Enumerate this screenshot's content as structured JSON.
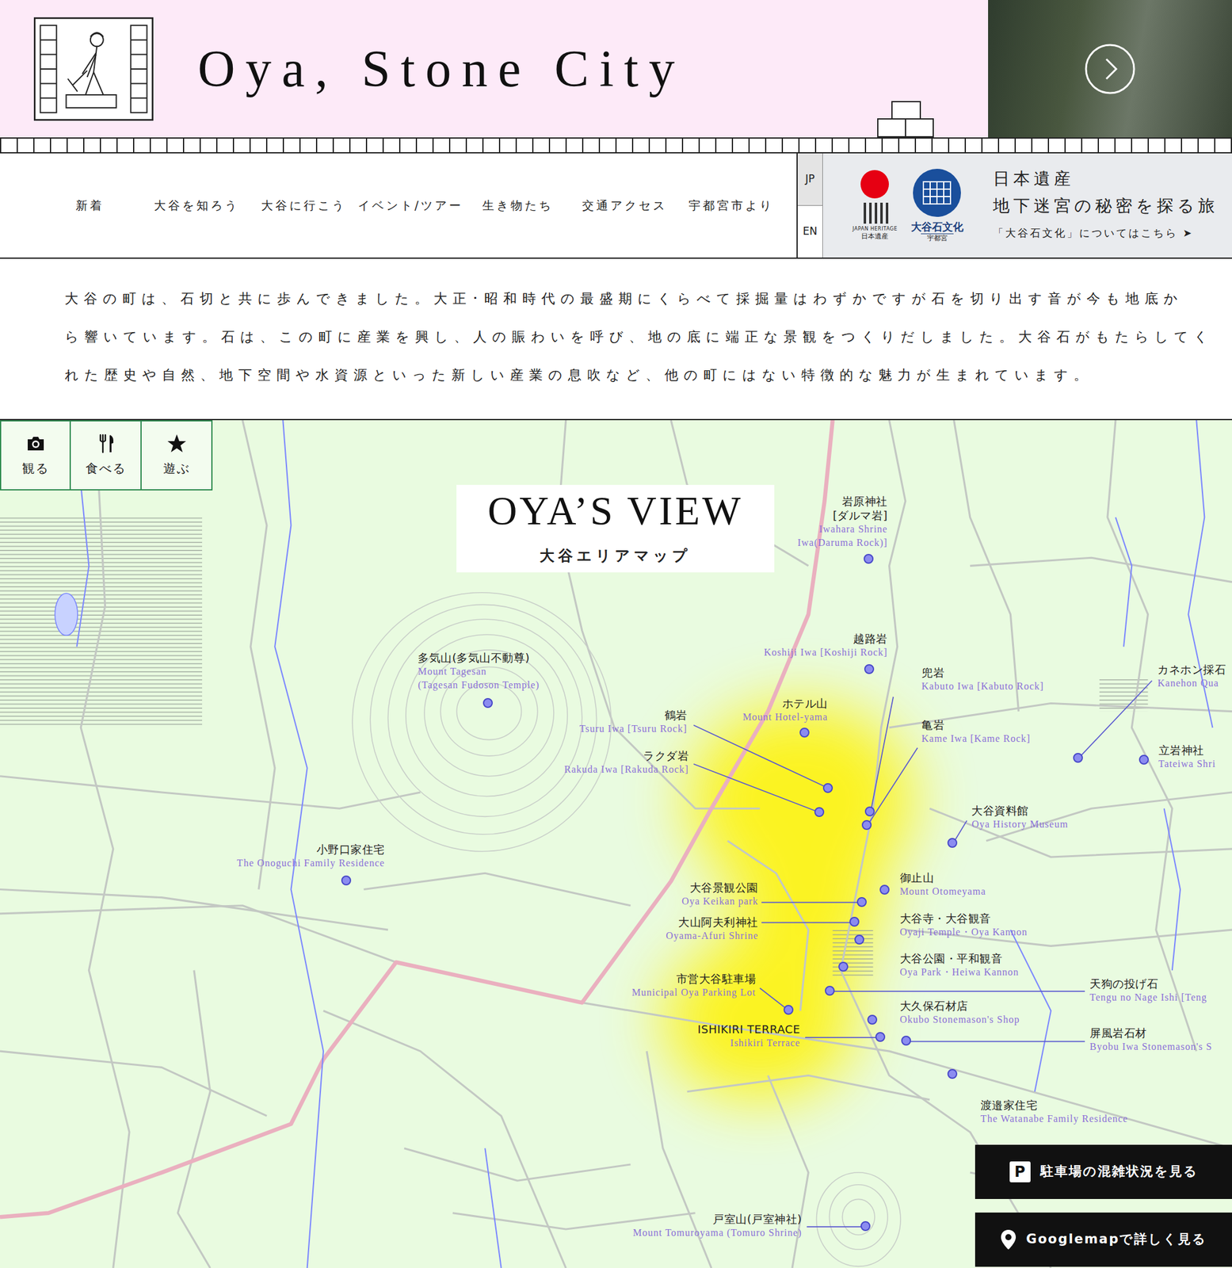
{
  "header": {
    "title": "Oya, Stone City"
  },
  "nav": {
    "items": [
      "新着",
      "大谷を知ろう",
      "大谷に行こう",
      "イベント/ツアー",
      "生き物たち",
      "交通アクセス",
      "宇都宮市より"
    ]
  },
  "languages": [
    {
      "label": "JP",
      "selected": true
    },
    {
      "label": "EN",
      "selected": false
    }
  ],
  "heritage_banner": {
    "logo1_caption_en": "JAPAN HERITAGE",
    "logo1_caption": "日本遺産",
    "logo2_title": "大谷石文化",
    "logo2_caption": "宇都宮",
    "title": "日本遺産",
    "subtitle": "地下迷宮の秘密を探る旅",
    "link": "「大谷石文化」についてはこちら",
    "link_arrow": "➤"
  },
  "intro": {
    "lines": [
      "大谷の町は、石切と共に歩んできました。大正･昭和時代の最盛期にくらべて採掘量はわずかですが石を切り出す音が今も地底か",
      "ら響いています。石は、この町に産業を興し、人の賑わいを呼び、地の底に端正な景観をつくりだしました。大谷石がもたらしてく",
      "れた歴史や自然、地下空間や水資源といった新しい産業の息吹など、他の町にはない特徴的な魅力が生まれています。"
    ]
  },
  "map": {
    "filters": [
      {
        "label": "観る",
        "kind": "camera"
      },
      {
        "label": "食べる",
        "kind": "food"
      },
      {
        "label": "遊ぶ",
        "kind": "star"
      }
    ],
    "title": "OYA’S VIEW",
    "subtitle": "大谷エリアマップ",
    "pins": [
      {
        "name": "岩原神社\n[ダルマ岩]",
        "name_en": "Iwahara Shrine\nIwa(Daruma Rock)]"
      },
      {
        "name": "越路岩",
        "name_en": "Koshiji Iwa [Koshiji Rock]"
      },
      {
        "name": "兜岩",
        "name_en": "Kabuto Iwa [Kabuto Rock]"
      },
      {
        "name": "亀岩",
        "name_en": "Kame Iwa [Kame Rock]"
      },
      {
        "name": "ホテル山",
        "name_en": "Mount Hotel-yama"
      },
      {
        "name": "鶴岩",
        "name_en": "Tsuru Iwa [Tsuru Rock]"
      },
      {
        "name": "ラクダ岩",
        "name_en": "Rakuda Iwa [Rakuda Rock]"
      },
      {
        "name": "多気山(多気山不動尊)",
        "name_en": "Mount Tagesan\n(Tagesan Fudoson Temple)"
      },
      {
        "name": "カネホン採石",
        "name_en": "Kanehon Qua"
      },
      {
        "name": "立岩神社",
        "name_en": "Tateiwa Shri"
      },
      {
        "name": "大谷資料館",
        "name_en": "Oya History Museum"
      },
      {
        "name": "小野口家住宅",
        "name_en": "The Onoguchi Family Residence"
      },
      {
        "name": "御止山",
        "name_en": "Mount Otomeyama"
      },
      {
        "name": "大谷景観公園",
        "name_en": "Oya Keikan park"
      },
      {
        "name": "大山阿夫利神社",
        "name_en": "Oyama-Afuri Shrine"
      },
      {
        "name": "大谷寺・大谷観音",
        "name_en": "Oyaji Temple・Oya Kannon"
      },
      {
        "name": "大谷公園・平和観音",
        "name_en": "Oya Park・Heiwa Kannon"
      },
      {
        "name": "天狗の投げ石",
        "name_en": "Tengu no Nage Ishi [Teng"
      },
      {
        "name": "市営大谷駐車場",
        "name_en": "Municipal Oya Parking Lot"
      },
      {
        "name": "大久保石材店",
        "name_en": "Okubo Stonemason's Shop"
      },
      {
        "name": "ISHIKIRI TERRACE",
        "name_en": "Ishikiri Terrace"
      },
      {
        "name": "屏風岩石材",
        "name_en": "Byobu Iwa Stonemason's S"
      },
      {
        "name": "渡邉家住宅",
        "name_en": "The Watanabe Family Residence"
      },
      {
        "name": "戸室山(戸室神社)",
        "name_en": "Mount Tomuroyama (Tomuro Shrine)"
      }
    ],
    "buttons": [
      {
        "label": "駐車場の混雑状況を見る",
        "kind": "parking",
        "icon": "P"
      },
      {
        "label": "Googlemapで詳しく見る",
        "kind": "googlemap"
      }
    ]
  }
}
